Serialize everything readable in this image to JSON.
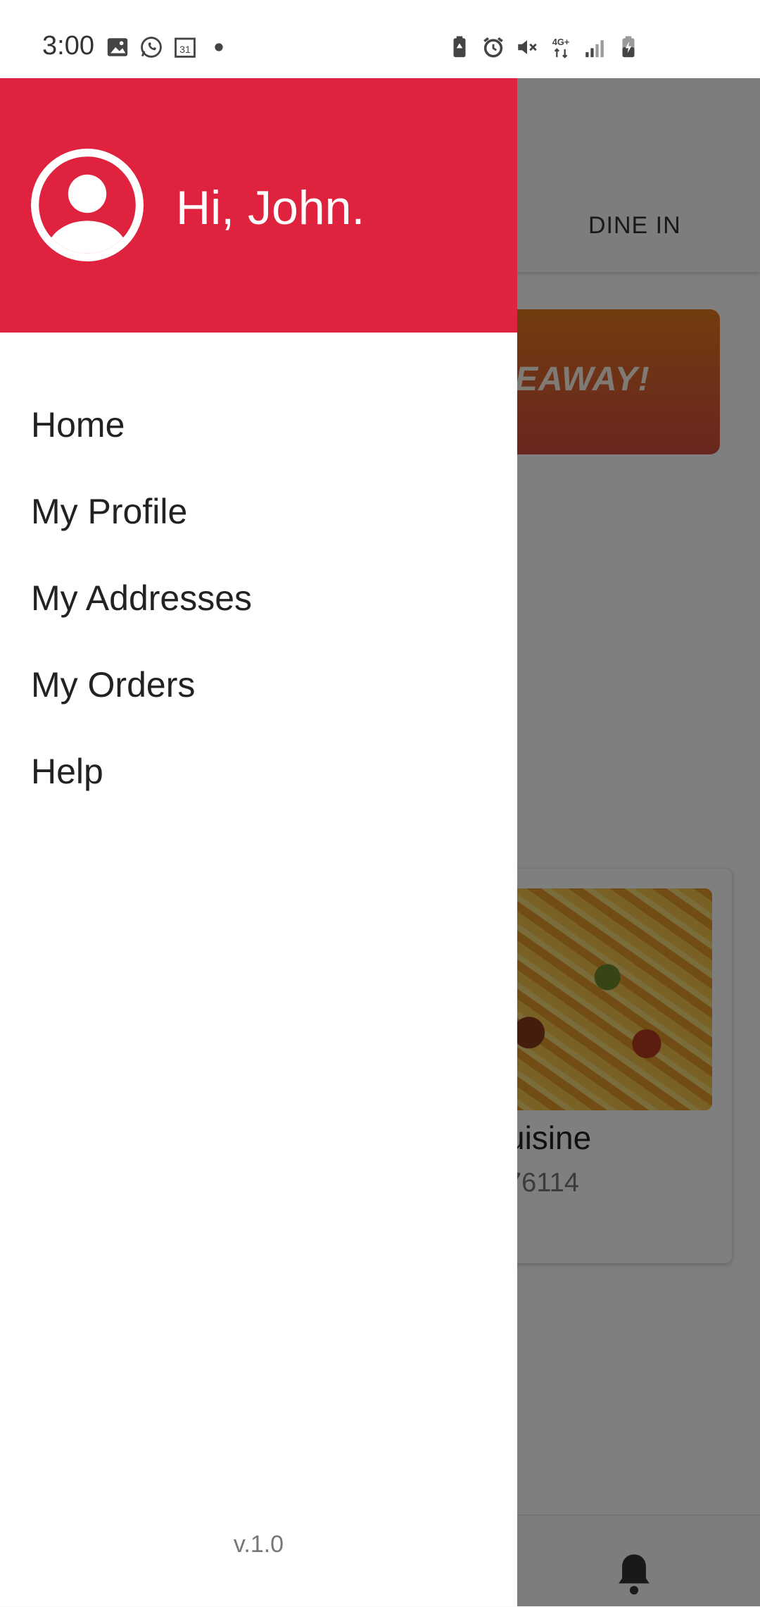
{
  "status_bar": {
    "time": "3:00",
    "left_icons": [
      "gallery-icon",
      "whatsapp-icon",
      "calendar-icon",
      "dot-icon"
    ],
    "right_icons": [
      "battery-saver-icon",
      "alarm-icon",
      "mute-icon",
      "4g-icon",
      "signal-icon",
      "battery-charging-icon"
    ],
    "calendar_day": "31"
  },
  "background": {
    "tab_label": "DINE IN",
    "banner_text": "EAWAY!",
    "card_title": "uisine",
    "card_subtitle": "76114"
  },
  "drawer": {
    "greeting": "Hi, John.",
    "menu": [
      {
        "label": "Home"
      },
      {
        "label": "My Profile"
      },
      {
        "label": "My Addresses"
      },
      {
        "label": "My Orders"
      },
      {
        "label": "Help"
      }
    ],
    "version": "v.1.0"
  },
  "colors": {
    "header": "#df223e",
    "scrim": "rgba(0,0,0,0.5)"
  }
}
